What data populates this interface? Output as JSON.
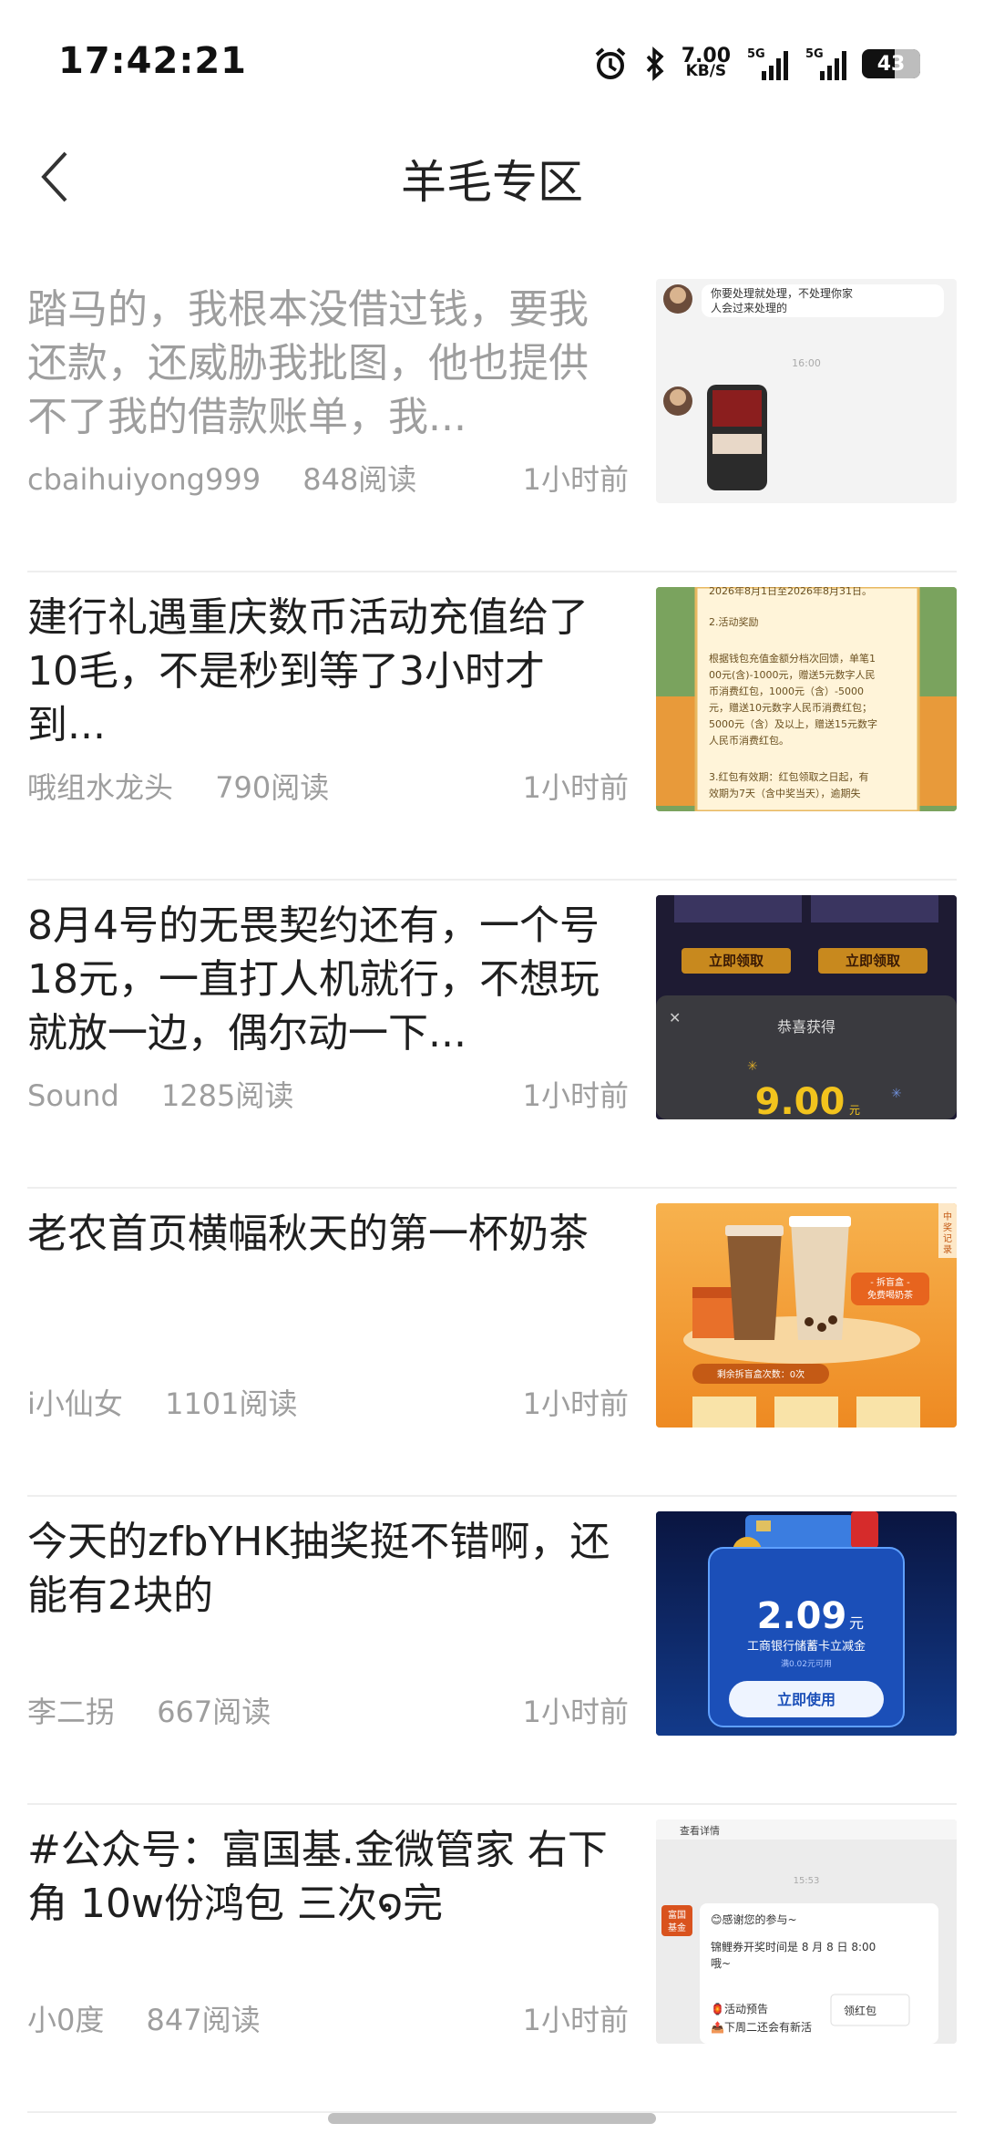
{
  "status_bar": {
    "time": "17:42:21",
    "net_speed_value": "7.00",
    "net_speed_unit": "KB/S",
    "signal1_label": "5G",
    "signal2_label": "5G",
    "battery": "43"
  },
  "header": {
    "title": "羊毛专区"
  },
  "articles": [
    {
      "title": "踏马的，我根本没借过钱，要我还款，还威胁我批图，他也提供不了我的借款账单，我...",
      "author": "cbaihuiyong999",
      "reads": "848阅读",
      "time": "1小时前",
      "read": true,
      "thumb": {
        "msg1": "你要处理就处理，不处理你家人会过来处理的",
        "chat_time": "16:00"
      }
    },
    {
      "title": "建行礼遇重庆数币活动充值给了10毛，不是秒到等了3小时才到...",
      "author": "哦组水龙头",
      "reads": "790阅读",
      "time": "1小时前",
      "read": false,
      "thumb": {
        "line1": "2026年8月1日至2026年8月31日。",
        "line2": "2.活动奖励",
        "line3": "根据钱包充值金额分档次回馈，单笔100元(含)-1000元，赠送5元数字人民币消费红包，1000元（含）-5000元，赠送10元数字人民币消费红包；5000元（含）及以上，赠送15元数字人民币消费红包。",
        "line4": "3.红包有效期：红包领取之日起，有效期为7天（含中奖当天），逾期失"
      }
    },
    {
      "title": "8月4号的无畏契约还有，一个号18元，一直打人机就行，不想玩就放一边，偶尔动一下...",
      "author": "Sound",
      "reads": "1285阅读",
      "time": "1小时前",
      "read": false,
      "thumb": {
        "btn1": "立即领取",
        "btn2": "立即领取",
        "popup_title": "恭喜获得",
        "amount": "9.00",
        "unit": "元"
      }
    },
    {
      "title": "老农首页横幅秋天的第一杯奶茶",
      "author": "i小仙女",
      "reads": "1101阅读",
      "time": "1小时前",
      "read": false,
      "thumb": {
        "badge": "拆盲盒 免费喝奶茶",
        "remaining": "剩余拆盲盒次数：0次",
        "side_tag": "中奖记录"
      }
    },
    {
      "title": "今天的zfbYHK抽奖挺不错啊，还能有2块的",
      "author": "李二拐",
      "reads": "667阅读",
      "time": "1小时前",
      "read": false,
      "thumb": {
        "amount": "2.09",
        "unit": "元",
        "desc": "工商银行储蓄卡立减金",
        "sub": "满0.02元可用",
        "button": "立即使用"
      }
    },
    {
      "title": "#公众号：富国基.金微管家 右下角 10w份鸿包 三次໑完",
      "author": "小0度",
      "reads": "847阅读",
      "time": "1小时前",
      "read": false,
      "thumb": {
        "header": "查看详情",
        "chat_time": "15:53",
        "avatar_text": "富国基金",
        "greet": "😊感谢您的参与~",
        "lottery": "锦鲤券开奖时间是 8 月 8 日 8:00 哦~",
        "preview": "🏮活动预告",
        "preview2": "📤下周二还会有新活",
        "red_packet": "领红包"
      }
    }
  ]
}
